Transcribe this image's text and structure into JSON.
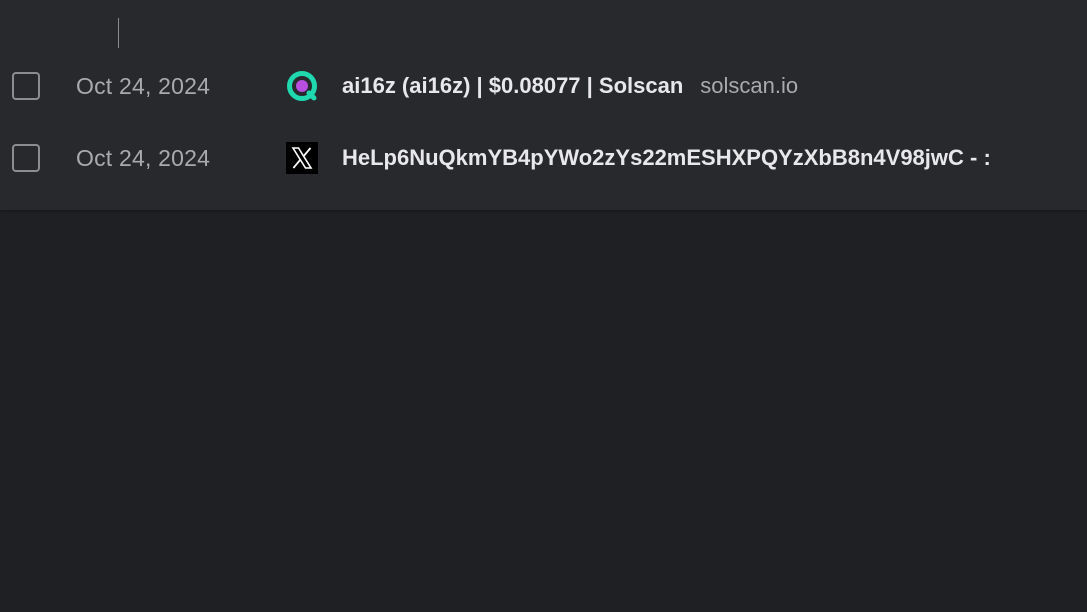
{
  "history": {
    "rows": [
      {
        "date": "Oct 24, 2024",
        "favicon": "solscan-icon",
        "title": "ai16z (ai16z) | $0.08077 | Solscan",
        "domain": "solscan.io",
        "checked": false
      },
      {
        "date": "Oct 24, 2024",
        "favicon": "x-icon",
        "title": "HeLp6NuQkmYB4pYWo2zYs22mESHXPQYzXbB8n4V98jwC - :",
        "domain": "",
        "checked": false
      }
    ]
  },
  "colors": {
    "background": "#1f2023",
    "panel": "#28292d",
    "text_primary": "#e8e8ea",
    "text_secondary": "#a9aaae",
    "solscan_teal": "#1fd8b0",
    "solscan_purple": "#b84fe0"
  }
}
